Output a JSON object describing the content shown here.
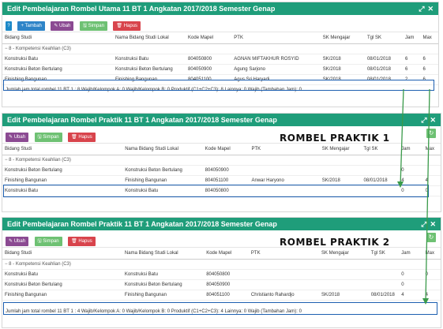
{
  "common": {
    "ctl_expand": "⤢",
    "ctl_close": "✕"
  },
  "panel1": {
    "title": "Edit Pembelajaran Rombel Utama 11 BT 1 Angkatan 2017/2018 Semester Genap",
    "buttons": {
      "help": "?",
      "add": "Tambah",
      "edit": "Ubah",
      "save": "Simpan",
      "delete": "Hapus"
    },
    "headers": [
      "Bidang Studi",
      "Nama Bidang Studi Lokal",
      "Kode Mapel",
      "PTK",
      "SK Mengajar",
      "Tgl SK",
      "Jam",
      "Max"
    ],
    "group": "8 - Kompetensi Keahlian (C3)",
    "rows": [
      [
        "Konstruksi Batu",
        "Konstruksi Batu",
        "804050800",
        "AGNAN MIFTAKHUR ROSYID",
        "SK/2018",
        "08/01/2018",
        "6",
        "6"
      ],
      [
        "Konstruksi Beton Bertulang",
        "Konstruksi Beton Bertulang",
        "804050900",
        "Agung Sarjono",
        "SK/2018",
        "08/01/2018",
        "6",
        "6"
      ],
      [
        "Finishing Bangunan",
        "Finishing Bangunan",
        "804051100",
        "Agus Sri Haryadi",
        "SK/2018",
        "08/01/2018",
        "2",
        "6"
      ]
    ],
    "footer": "Jumlah jam total rombel 11 BT 1 : 8    Wajib/Kelompok A: 0    Wajib/Kelompok B: 0    Produktif (C1+C2+C3): 8    Lainnya: 0    Wajib (Tambahan Jam): 0"
  },
  "panel2": {
    "title": "Edit Pembelajaran Rombel Praktik 11 BT 1 Angkatan 2017/2018 Semester Genap",
    "buttons": {
      "edit": "Ubah",
      "save": "Simpan",
      "delete": "Hapus"
    },
    "headers": [
      "Bidang Studi",
      "Nama Bidang Studi Lokal",
      "Kode Mapel",
      "PTK",
      "SK Mengajar",
      "Tgl SK",
      "Jam",
      "Max"
    ],
    "group": "8 - Kompetensi Keahlian (C3)",
    "rows": [
      [
        "Konstruksi Beton Bertulang",
        "Konstruksi Beton Bertulang",
        "804050900",
        "",
        "",
        "",
        "0",
        ""
      ],
      [
        "Finishing Bangunan",
        "Finishing Bangunan",
        "804051100",
        "Anwar Haryono",
        "SK/2018",
        "08/01/2018",
        "4",
        "4"
      ],
      [
        "Konstruksi Batu",
        "Konstruksi Batu",
        "804050800",
        "",
        "",
        "",
        "0",
        "0"
      ]
    ],
    "label": "ROMBEL PRAKTIK 1"
  },
  "panel3": {
    "title": "Edit Pembelajaran Rombel Praktik 11 BT 1 Angkatan 2017/2018 Semester Genap",
    "buttons": {
      "edit": "Ubah",
      "save": "Simpan",
      "delete": "Hapus"
    },
    "headers": [
      "Bidang Studi",
      "Nama Bidang Studi Lokal",
      "Kode Mapel",
      "PTK",
      "SK Mengajar",
      "Tgl SK",
      "Jam",
      "Max"
    ],
    "group": "8 - Kompetensi Keahlian (C3)",
    "rows": [
      [
        "Konstruksi Batu",
        "Konstruksi Batu",
        "804050800",
        "",
        "",
        "",
        "0",
        "0"
      ],
      [
        "Konstruksi Beton Bertulang",
        "Konstruksi Beton Bertulang",
        "804050900",
        "",
        "",
        "",
        "0",
        ""
      ],
      [
        "Finishing Bangunan",
        "Finishing Bangunan",
        "804051100",
        "Christianto Rahardjo",
        "SK/2018",
        "08/01/2018",
        "4",
        "4"
      ]
    ],
    "label": "ROMBEL PRAKTIK 2",
    "footer": "Jumlah jam total rombel 11 BT 1 : 4    Wajib/Kelompok A: 0    Wajib/Kelompok B: 0    Produktif (C1+C2+C3): 4    Lainnya: 0    Wajib (Tambahan Jam): 0"
  }
}
